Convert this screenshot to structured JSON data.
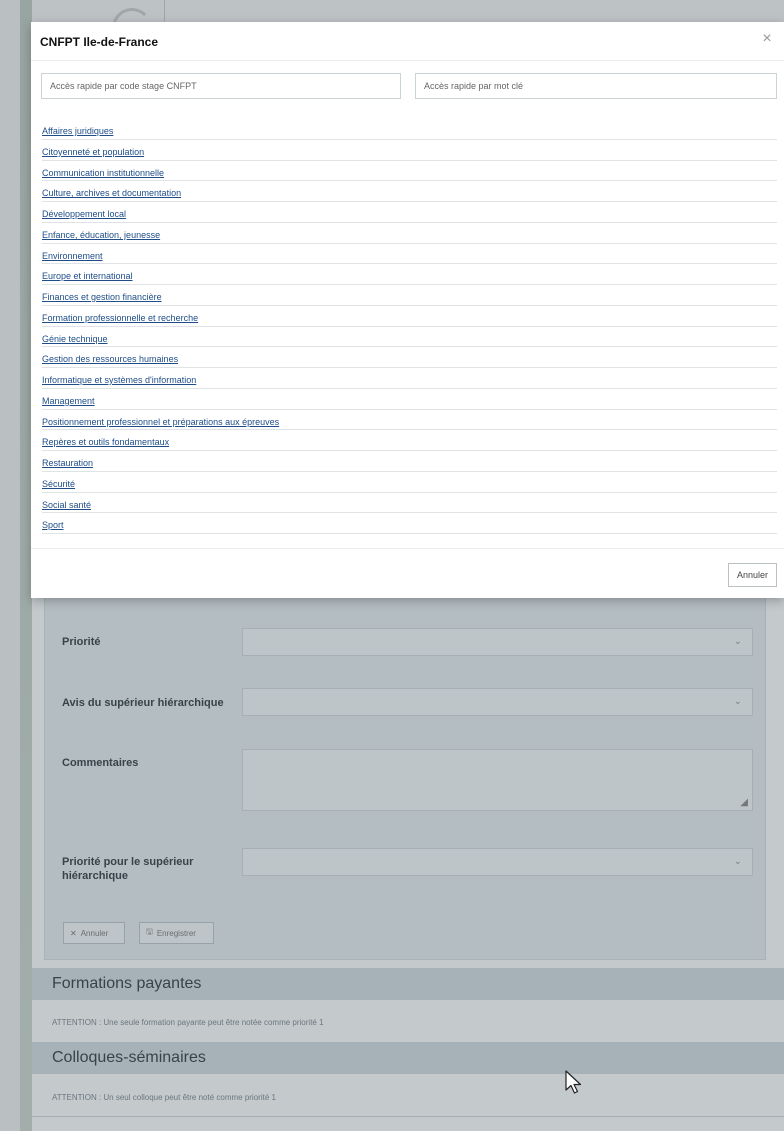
{
  "modal": {
    "title": "CNFPT Ile-de-France",
    "close_symbol": "×",
    "search_code_placeholder": "Accès rapide par code stage CNFPT",
    "search_keyword_placeholder": "Accès rapide par mot clé",
    "categories": [
      "Affaires juridiques",
      "Citoyenneté et population",
      "Communication institutionnelle",
      "Culture, archives et documentation",
      "Développement local",
      "Enfance, éducation, jeunesse",
      "Environnement",
      "Europe et international",
      "Finances et gestion financière",
      "Formation professionnelle et recherche",
      "Génie technique",
      "Gestion des ressources humaines",
      "Informatique et systèmes d'information",
      "Management",
      "Positionnement professionnel et préparations aux épreuves",
      "Repères et outils fondamentaux",
      "Restauration",
      "Sécurité",
      "Social santé",
      "Sport"
    ],
    "cancel_label": "Annuler"
  },
  "form": {
    "priority_label": "Priorité",
    "supervisor_opinion_label": "Avis du supérieur hiérarchique",
    "comments_label": "Commentaires",
    "supervisor_priority_label": "Priorité pour le supérieur hiérarchique",
    "cancel_label": "Annuler",
    "save_label": "Enregistrer"
  },
  "sections": {
    "paid_title": "Formations payantes",
    "paid_note": "ATTENTION : Une seule formation payante peut être notée comme priorité 1",
    "seminars_title": "Colloques-séminaires",
    "seminars_note": "ATTENTION : Un seul colloque peut être noté comme priorité 1"
  },
  "icons": {
    "close": "close-icon",
    "chevron": "chevron-down-icon",
    "resize": "resize-grip-icon",
    "save": "save-icon",
    "cancel": "close-icon",
    "cursor": "mouse-cursor-icon"
  },
  "colors": {
    "link": "#1e4d88",
    "overlay": "#465860",
    "section_band": "#d3dde2"
  }
}
